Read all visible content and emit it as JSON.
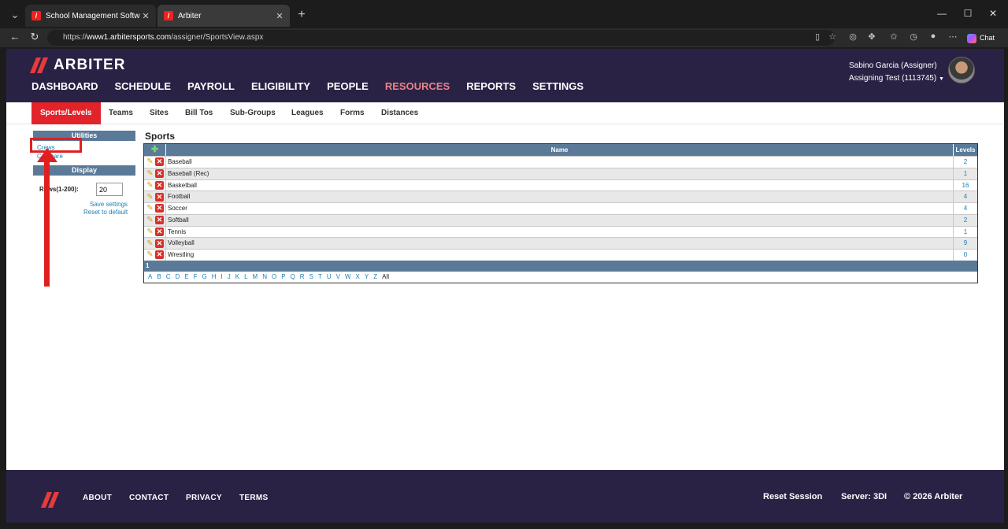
{
  "browser": {
    "tabs": [
      {
        "title": "School Management Software for",
        "active": false
      },
      {
        "title": "Arbiter",
        "active": true
      }
    ],
    "url_prefix": "https://",
    "url_host": "www1.arbitersports.com",
    "url_path": "/assigner/SportsView.aspx",
    "chat_label": "Chat"
  },
  "site": {
    "logo_text": "ARBITER",
    "main_nav": [
      "DASHBOARD",
      "SCHEDULE",
      "PAYROLL",
      "ELIGIBILITY",
      "PEOPLE",
      "RESOURCES",
      "REPORTS",
      "SETTINGS"
    ],
    "active_main_nav": "RESOURCES",
    "user_name": "Sabino Garcia (Assigner)",
    "user_group": "Assigning Test (1113745)",
    "sub_nav": [
      "Sports/Levels",
      "Teams",
      "Sites",
      "Bill Tos",
      "Sub-Groups",
      "Leagues",
      "Forms",
      "Distances"
    ],
    "active_sub_nav": "Sports/Levels"
  },
  "sidebar": {
    "utilities_title": "Utilities",
    "utilities_links": [
      "Crews",
      "Compare"
    ],
    "display_title": "Display",
    "rows_label": "Rows(1-200):",
    "rows_value": "20",
    "save_settings": "Save settings",
    "reset_default": "Reset to default"
  },
  "sports": {
    "title": "Sports",
    "col_name": "Name",
    "col_levels": "Levels",
    "rows": [
      {
        "name": "Baseball",
        "levels": "2"
      },
      {
        "name": "Baseball (Rec)",
        "levels": "1"
      },
      {
        "name": "Basketball",
        "levels": "16"
      },
      {
        "name": "Football",
        "levels": "4"
      },
      {
        "name": "Soccer",
        "levels": "4"
      },
      {
        "name": "Softball",
        "levels": "2"
      },
      {
        "name": "Tennis",
        "levels": "1"
      },
      {
        "name": "Volleyball",
        "levels": "9"
      },
      {
        "name": "Wrestling",
        "levels": "0"
      }
    ],
    "page": "1",
    "alpha": [
      "A",
      "B",
      "C",
      "D",
      "E",
      "F",
      "G",
      "H",
      "I",
      "J",
      "K",
      "L",
      "M",
      "N",
      "O",
      "P",
      "Q",
      "R",
      "S",
      "T",
      "U",
      "V",
      "W",
      "X",
      "Y",
      "Z"
    ],
    "alpha_all": "All"
  },
  "footer": {
    "links": [
      "ABOUT",
      "CONTACT",
      "PRIVACY",
      "TERMS"
    ],
    "reset_session": "Reset Session",
    "server": "Server: 3DI",
    "copyright": "© 2026 Arbiter"
  },
  "colors": {
    "header_bg": "#2a2244",
    "accent_red": "#e3232a",
    "table_head": "#5a7a98",
    "link_blue": "#1a7fb6"
  }
}
